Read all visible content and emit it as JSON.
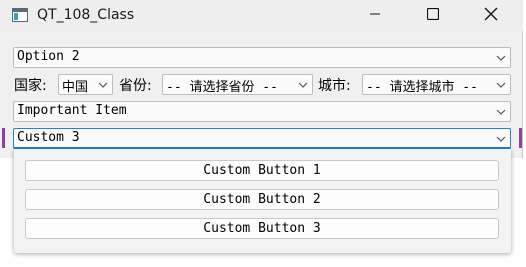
{
  "window": {
    "title": "QT_108_Class",
    "icons": {
      "app": "qt-app-icon",
      "minimize": "minimize-icon",
      "maximize": "maximize-icon",
      "close": "close-icon"
    }
  },
  "combos": {
    "option": {
      "value": "Option 2"
    },
    "country": {
      "label": "国家:",
      "value": "中国"
    },
    "province": {
      "label": "省份:",
      "value": "-- 请选择省份 --"
    },
    "city": {
      "label": "城市:",
      "value": "-- 请选择城市 --"
    },
    "item": {
      "value": "Important Item"
    },
    "custom": {
      "value": "Custom 3"
    }
  },
  "popup": {
    "buttons": [
      "Custom Button 1",
      "Custom Button 2",
      "Custom Button 3"
    ]
  },
  "colors": {
    "focus": "#2b7fd4",
    "accent": "#8e3fa8",
    "window_bg": "#f0f0f0"
  }
}
